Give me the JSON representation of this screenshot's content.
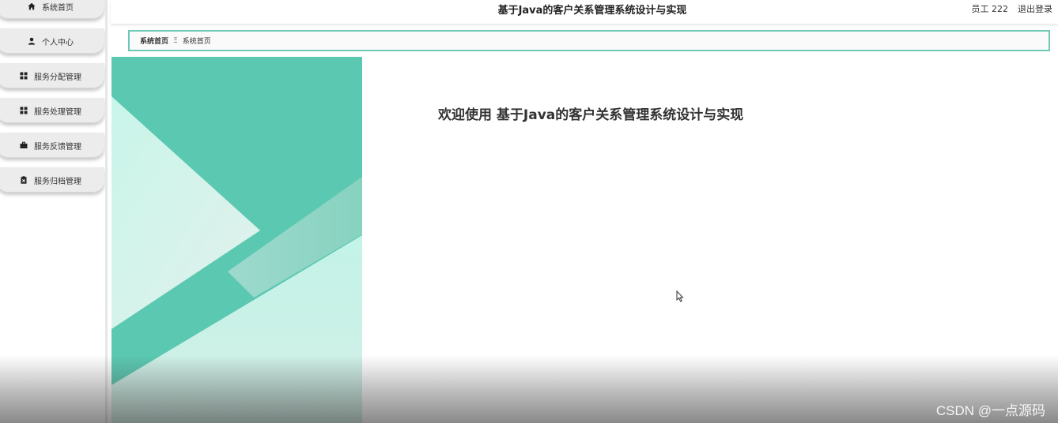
{
  "sidebar": {
    "items": [
      {
        "label": "系统首页",
        "icon": "home-icon"
      },
      {
        "label": "个人中心",
        "icon": "user-icon"
      },
      {
        "label": "服务分配管理",
        "icon": "grid-icon"
      },
      {
        "label": "服务处理管理",
        "icon": "grid-icon"
      },
      {
        "label": "服务反馈管理",
        "icon": "briefcase-icon"
      },
      {
        "label": "服务归档管理",
        "icon": "clipboard-icon"
      }
    ]
  },
  "header": {
    "title": "基于Java的客户关系管理系统设计与实现",
    "user": "员工 222",
    "logout": "退出登录"
  },
  "breadcrumb": {
    "home": "系统首页",
    "separator": "Ξ",
    "current": "系统首页"
  },
  "main": {
    "welcome": "欢迎使用 基于Java的客户关系管理系统设计与实现"
  },
  "watermark": "CSDN @一点源码",
  "colors": {
    "accent": "#5bc8b1",
    "accent_light": "#c8f3e9",
    "breadcrumb_border": "#6fc8b5"
  }
}
